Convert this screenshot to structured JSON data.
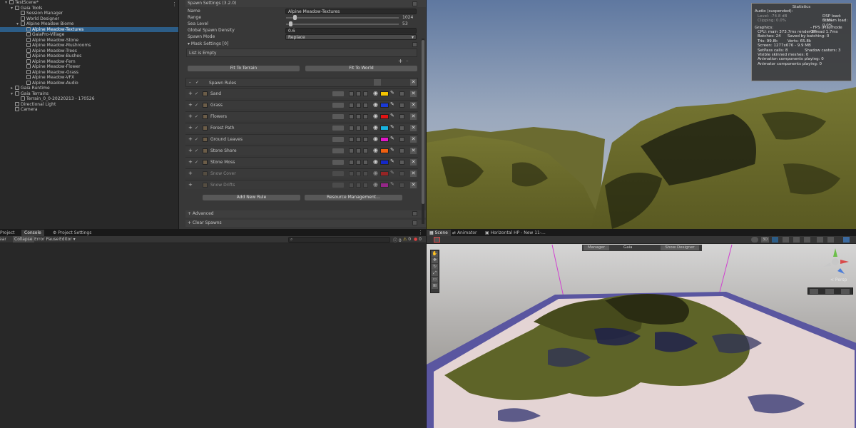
{
  "hierarchy": {
    "items": [
      {
        "label": "TestScene*",
        "depth": 0,
        "arrow": "▾",
        "selected": false
      },
      {
        "label": "Gaia Tools",
        "depth": 1,
        "arrow": "▾",
        "selected": false
      },
      {
        "label": "Session Manager",
        "depth": 2,
        "arrow": "",
        "selected": false
      },
      {
        "label": "World Designer",
        "depth": 2,
        "arrow": "",
        "selected": false
      },
      {
        "label": "Alpine Meadow Biome",
        "depth": 2,
        "arrow": "▾",
        "selected": false
      },
      {
        "label": "Alpine Meadow-Textures",
        "depth": 3,
        "arrow": "",
        "selected": true
      },
      {
        "label": "GaiaPro-Village",
        "depth": 3,
        "arrow": "",
        "selected": false
      },
      {
        "label": "Alpine Meadow-Stone",
        "depth": 3,
        "arrow": "",
        "selected": false
      },
      {
        "label": "Alpine Meadow-Mushrooms",
        "depth": 3,
        "arrow": "",
        "selected": false
      },
      {
        "label": "Alpine Meadow-Trees",
        "depth": 3,
        "arrow": "",
        "selected": false
      },
      {
        "label": "Alpine Meadow-Bushes",
        "depth": 3,
        "arrow": "",
        "selected": false
      },
      {
        "label": "Alpine Meadow-Fern",
        "depth": 3,
        "arrow": "",
        "selected": false
      },
      {
        "label": "Alpine Meadow-Flower",
        "depth": 3,
        "arrow": "",
        "selected": false
      },
      {
        "label": "Alpine Meadow-Grass",
        "depth": 3,
        "arrow": "",
        "selected": false
      },
      {
        "label": "Alpine Meadow-VFX",
        "depth": 3,
        "arrow": "",
        "selected": false
      },
      {
        "label": "Alpine Meadow-Audio",
        "depth": 3,
        "arrow": "",
        "selected": false
      },
      {
        "label": "Gaia Runtime",
        "depth": 1,
        "arrow": "▸",
        "selected": false
      },
      {
        "label": "Gaia Terrains",
        "depth": 1,
        "arrow": "▾",
        "selected": false
      },
      {
        "label": "Terrain_0_0-20220213 - 170526",
        "depth": 2,
        "arrow": "",
        "selected": false
      },
      {
        "label": "Directional Light",
        "depth": 1,
        "arrow": "",
        "selected": false
      },
      {
        "label": "Camera",
        "depth": 1,
        "arrow": "",
        "selected": false
      }
    ]
  },
  "inspector": {
    "spawn_settings_title": "Spawn Settings (3.2.0)",
    "name_label": "Name",
    "name_value": "Alpine Meadow-Textures",
    "range_label": "Range",
    "range_value": "1024",
    "range_fraction": 0.0,
    "sea_label": "Sea Level",
    "sea_value": "53",
    "sea_fraction": 0.0,
    "density_label": "Global Spawn Density",
    "density_value": "0.6",
    "mode_label": "Spawn Mode",
    "mode_value": "Replace",
    "mask_label": "▾ Mask Settings [0]",
    "list_empty": "List is Empty",
    "fit_terrain": "Fit To Terrain",
    "fit_world": "Fit To World",
    "spawn_rules_label": "Spawn Rules",
    "rules": [
      {
        "name": "Sand",
        "color": "#f5c400",
        "enabled": true
      },
      {
        "name": "Grass",
        "color": "#1a3ad8",
        "enabled": true
      },
      {
        "name": "Flowers",
        "color": "#e01414",
        "enabled": true
      },
      {
        "name": "Forest Path",
        "color": "#18b4e0",
        "enabled": true
      },
      {
        "name": "Ground Leaves",
        "color": "#e018c8",
        "enabled": true
      },
      {
        "name": "Stone Shore",
        "color": "#f06010",
        "enabled": true
      },
      {
        "name": "Stone Moss",
        "color": "#1428c8",
        "enabled": true
      },
      {
        "name": "Snow Cover",
        "color": "#e01414",
        "enabled": false
      },
      {
        "name": "Snow Drifts",
        "color": "#e018c8",
        "enabled": false
      }
    ],
    "add_rule": "Add New Rule",
    "resource_mgmt": "Resource Management...",
    "advanced": "+ Advanced",
    "clear_spawns": "+ Clear Spawns"
  },
  "console": {
    "tabs": [
      "Project",
      "Console",
      "Project Settings"
    ],
    "toolbar": [
      "ear",
      "Collapse",
      "Error Pause",
      "Editor ▾"
    ],
    "counts": [
      "0",
      "0",
      "0"
    ]
  },
  "stats": {
    "title": "Statistics",
    "audio": "Audio (suspended):",
    "level": "Level: -74.8 dB",
    "dsp": "DSP load: 0.2%",
    "clip": "Clipping: 0.0%",
    "stream": "Stream load: 0.0%",
    "graphics": "Graphics:",
    "fps": "- FPS (Playmode Off",
    "cpu": "CPU: main 373.7ms  render thread 1.7ms",
    "batches": "Batches: 24",
    "saved": "Saved by batching: 0",
    "tris": "Tris: 99.8k",
    "verts": "Verts: 65.8k",
    "screen": "Screen: 1277x676 - 9.9 MB",
    "setpass": "SetPass calls: 8",
    "shadow": "Shadow casters: 3",
    "skinned": "Visible skinned meshes: 0",
    "anim": "Animation components playing: 0",
    "animator": "Animator components playing: 0"
  },
  "scene": {
    "tabs": [
      "Scene",
      "Animator",
      "Horizontal HP - New 11-..."
    ],
    "gaia_bar": [
      "Manager",
      "Gaia",
      "Show Designer"
    ],
    "persp": "< Persp",
    "mode_3d": "3D"
  }
}
